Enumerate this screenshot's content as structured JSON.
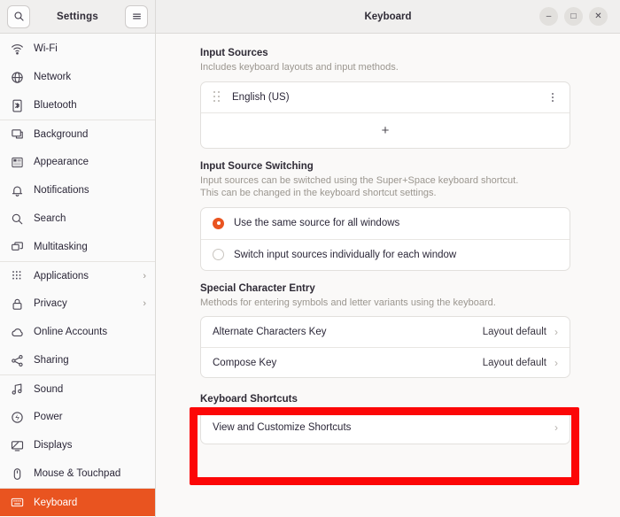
{
  "sidebar": {
    "title": "Settings",
    "search_icon": "search-icon",
    "menu_icon": "hamburger-menu-icon",
    "items": [
      {
        "label": "Wi-Fi",
        "icon": "wifi-icon",
        "chevron": "",
        "group_start": false,
        "active": false
      },
      {
        "label": "Network",
        "icon": "network-globe-icon",
        "chevron": "",
        "group_start": false,
        "active": false
      },
      {
        "label": "Bluetooth",
        "icon": "bluetooth-icon",
        "chevron": "",
        "group_start": false,
        "active": false
      },
      {
        "label": "Background",
        "icon": "background-icon",
        "chevron": "",
        "group_start": true,
        "active": false
      },
      {
        "label": "Appearance",
        "icon": "appearance-icon",
        "chevron": "",
        "group_start": false,
        "active": false
      },
      {
        "label": "Notifications",
        "icon": "bell-icon",
        "chevron": "",
        "group_start": false,
        "active": false
      },
      {
        "label": "Search",
        "icon": "search-icon",
        "chevron": "",
        "group_start": false,
        "active": false
      },
      {
        "label": "Multitasking",
        "icon": "multitasking-icon",
        "chevron": "",
        "group_start": false,
        "active": false
      },
      {
        "label": "Applications",
        "icon": "applications-grid-icon",
        "chevron": "›",
        "group_start": true,
        "active": false
      },
      {
        "label": "Privacy",
        "icon": "lock-icon",
        "chevron": "›",
        "group_start": false,
        "active": false
      },
      {
        "label": "Online Accounts",
        "icon": "cloud-icon",
        "chevron": "",
        "group_start": false,
        "active": false
      },
      {
        "label": "Sharing",
        "icon": "share-icon",
        "chevron": "",
        "group_start": false,
        "active": false
      },
      {
        "label": "Sound",
        "icon": "sound-note-icon",
        "chevron": "",
        "group_start": true,
        "active": false
      },
      {
        "label": "Power",
        "icon": "power-icon",
        "chevron": "",
        "group_start": false,
        "active": false
      },
      {
        "label": "Displays",
        "icon": "displays-icon",
        "chevron": "",
        "group_start": false,
        "active": false
      },
      {
        "label": "Mouse & Touchpad",
        "icon": "mouse-icon",
        "chevron": "",
        "group_start": false,
        "active": false
      },
      {
        "label": "Keyboard",
        "icon": "keyboard-icon",
        "chevron": "",
        "group_start": true,
        "active": true
      }
    ]
  },
  "window": {
    "title": "Keyboard",
    "minimize_label": "–",
    "maximize_label": "□",
    "close_label": "✕"
  },
  "sections": {
    "input_sources": {
      "title": "Input Sources",
      "description": "Includes keyboard layouts and input methods.",
      "entries": [
        {
          "label": "English (US)",
          "menu_icon": "overflow-menu-icon"
        }
      ],
      "add_label": "+"
    },
    "input_source_switching": {
      "title": "Input Source Switching",
      "description_line1": "Input sources can be switched using the Super+Space keyboard shortcut.",
      "description_line2": "This can be changed in the keyboard shortcut settings.",
      "options": [
        {
          "label": "Use the same source for all windows",
          "selected": true
        },
        {
          "label": "Switch input sources individually for each window",
          "selected": false
        }
      ]
    },
    "special_character_entry": {
      "title": "Special Character Entry",
      "description": "Methods for entering symbols and letter variants using the keyboard.",
      "rows": [
        {
          "label": "Alternate Characters Key",
          "value": "Layout default",
          "chevron": "›"
        },
        {
          "label": "Compose Key",
          "value": "Layout default",
          "chevron": "›"
        }
      ]
    },
    "keyboard_shortcuts": {
      "title": "Keyboard Shortcuts",
      "rows": [
        {
          "label": "View and Customize Shortcuts",
          "value": "",
          "chevron": "›"
        }
      ]
    }
  },
  "annotation": {
    "highlight_color": "#fc0707",
    "target": "keyboard-shortcuts-section"
  },
  "colors": {
    "accent": "#e95420",
    "sidebar_bg": "#fafafa",
    "content_bg": "#faf9f8",
    "card_bg": "#ffffff"
  }
}
